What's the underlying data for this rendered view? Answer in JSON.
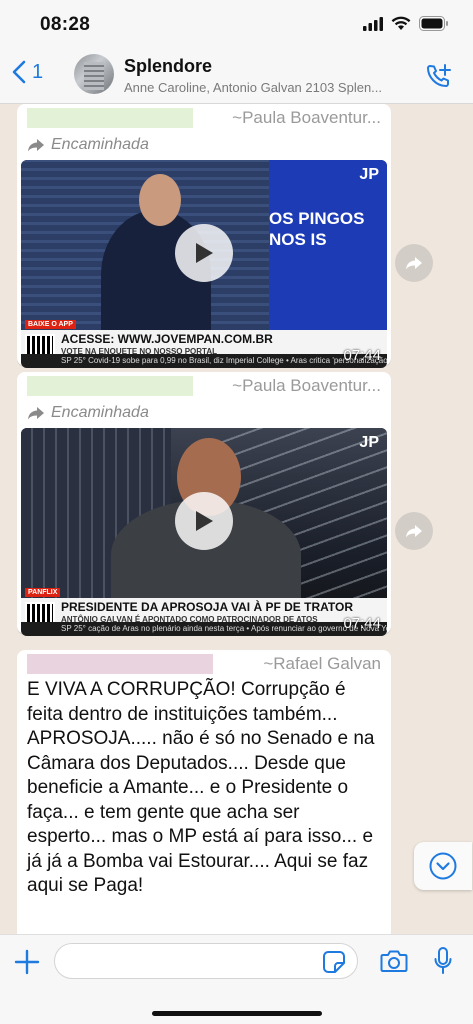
{
  "status_bar": {
    "time": "08:28"
  },
  "header": {
    "back_count": "1",
    "title": "Splendore",
    "subtitle": "Anne Caroline, Antonio Galvan 2103 Splen..."
  },
  "messages": [
    {
      "sender": "~Paula Boaventur...",
      "forwarded_label": "Encaminhada",
      "video": {
        "duration": "07:44",
        "channel_text": "OS PINGOS NOS IS",
        "logo": "JP",
        "lower_third_tag": "BAIXE O APP",
        "lower_third_main": "ACESSE: WWW.JOVEMPAN.COM.BR",
        "lower_third_sub": "VOTE NA ENQUETE NO NOSSO PORTAL",
        "ticker": "SP 25° Covid-19 sobe para 0,99 no Brasil, diz Imperial College • Aras critica 'personalização'"
      }
    },
    {
      "sender": "~Paula Boaventur...",
      "forwarded_label": "Encaminhada",
      "video": {
        "duration": "07:44",
        "logo": "JP",
        "lower_third_tag": "PANFLIX",
        "lower_third_main": "PRESIDENTE DA APROSOJA VAI À PF DE TRATOR",
        "lower_third_sub": "ANTÔNIO GALVAN É APONTADO COMO PATROCINADOR DE ATOS ANTIDEMOCRÁTICOS",
        "ticker": "SP 25° cação de Aras no plenário ainda nesta terça • Após renunciar ao governo de Nova York"
      }
    },
    {
      "sender": "~Rafael Galvan",
      "text": "E VIVA A CORRUPÇÃO! Corrupção é feita dentro de instituições também... APROSOJA.....  não é só no Senado e na Câmara dos Deputados.... Desde que beneficie a Amante... e o Presidente o faça... e tem gente que acha ser esperto... mas o MP está aí para isso... e já já a Bomba vai Estourar.... Aqui se faz aqui se Paga!"
    }
  ],
  "input": {
    "placeholder": "",
    "value": ""
  },
  "icons": {
    "back": "chevron-left-icon",
    "call": "add-call-icon",
    "forward": "forward-arrow-icon",
    "play": "play-icon",
    "share": "share-icon",
    "scroll": "chevron-down-icon",
    "plus": "plus-icon",
    "sticker": "sticker-icon",
    "camera": "camera-icon",
    "mic": "microphone-icon"
  },
  "colors": {
    "accent": "#1f7ae0",
    "chat_bg": "#efe7dd",
    "bubble": "#ffffff"
  }
}
